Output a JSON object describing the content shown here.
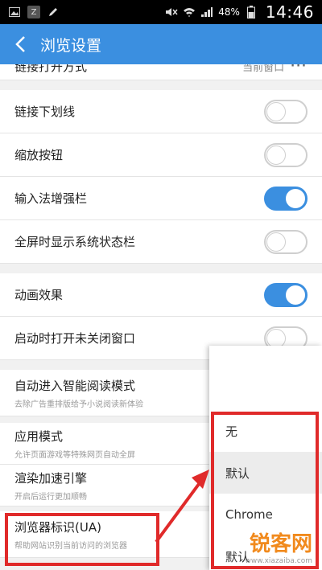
{
  "status_bar": {
    "clock": "14:46",
    "battery_pct": "48%",
    "icons": [
      "image-icon",
      "app-z-icon",
      "pencil-icon",
      "mute-icon",
      "wifi-icon",
      "signal-icon",
      "battery-icon"
    ],
    "app_z": "Z"
  },
  "app_bar": {
    "back_icon": "chevron-left-icon",
    "title": "浏览设置"
  },
  "settings": {
    "link_open": {
      "label": "链接打开方式",
      "value": "当前窗口",
      "more": "···"
    },
    "link_underline": {
      "label": "链接下划线",
      "on": false
    },
    "zoom_buttons": {
      "label": "缩放按钮",
      "on": false
    },
    "ime_bar": {
      "label": "输入法增强栏",
      "on": true
    },
    "fullscreen_statusbar": {
      "label": "全屏时显示系统状态栏",
      "on": false
    },
    "animation": {
      "label": "动画效果",
      "on": true
    },
    "restore_windows": {
      "label": "启动时打开未关闭窗口",
      "on": false
    },
    "smart_reading": {
      "label": "自动进入智能阅读模式",
      "sub": "去除广告重排版给予小说阅读新体验",
      "on": true
    },
    "app_mode": {
      "label": "应用模式",
      "sub": "允许页面游戏等特殊网页自动全屏"
    },
    "render_engine": {
      "label": "渲染加速引擎",
      "sub": "开启后运行更加顺畅"
    },
    "ua": {
      "label": "浏览器标识(UA)",
      "sub": "帮助网站识别当前访问的浏览器"
    }
  },
  "ua_popup": {
    "options": [
      {
        "label": "无",
        "selected": false
      },
      {
        "label": "默认",
        "selected": true
      },
      {
        "label": "Chrome",
        "selected": false
      },
      {
        "label": "默认",
        "selected": false
      }
    ]
  },
  "watermark": {
    "big": "锐客网",
    "small": "www.xiazaiba.com"
  },
  "colors": {
    "accent": "#3b8fe0",
    "highlight": "#e02a2a",
    "watermark": "#f18a1d"
  }
}
